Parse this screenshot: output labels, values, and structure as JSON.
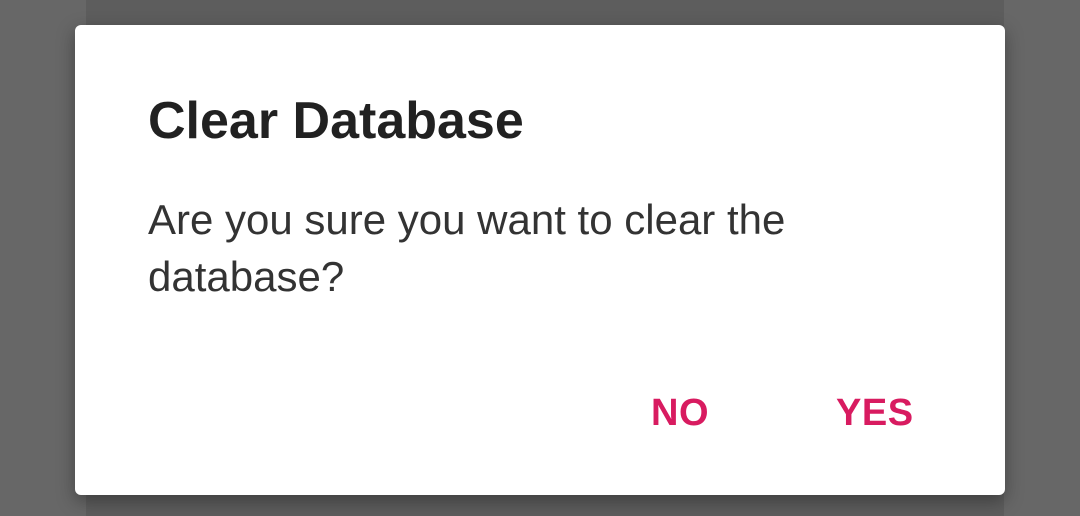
{
  "dialog": {
    "title": "Clear Database",
    "message": "Are you sure you want to clear the database?",
    "buttons": {
      "no_label": "NO",
      "yes_label": "YES"
    }
  },
  "colors": {
    "accent": "#d81b60",
    "scrim": "#5d5d5d",
    "surface": "#ffffff",
    "title_text": "#212121",
    "body_text": "#333333"
  }
}
